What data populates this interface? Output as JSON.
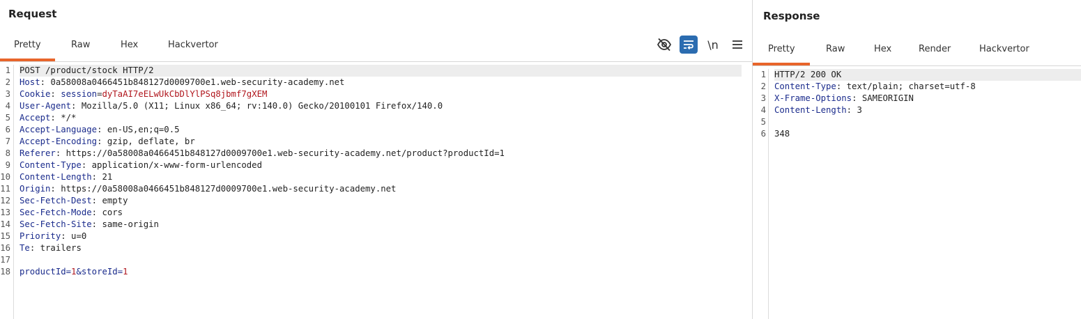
{
  "request": {
    "title": "Request",
    "tabs": [
      {
        "label": "Pretty",
        "active": true
      },
      {
        "label": "Raw",
        "active": false
      },
      {
        "label": "Hex",
        "active": false
      },
      {
        "label": "Hackvertor",
        "active": false
      }
    ],
    "toolbar": {
      "hide_icon": "eye-slash-icon",
      "wrap_icon": "word-wrap-icon",
      "newline_label": "\\n",
      "menu_icon": "hamburger-menu-icon"
    },
    "lines": [
      {
        "n": "1",
        "text": "POST /product/stock HTTP/2"
      },
      {
        "n": "2",
        "name": "Host",
        "sep": ": ",
        "value": "0a58008a0466451b848127d0009700e1.web-security-academy.net"
      },
      {
        "n": "3",
        "name": "Cookie",
        "sep": ": ",
        "cname": "session",
        "ceq": "=",
        "cvalue": "dyTaAI7eELwUkCbDlYlPSq8jbmf7gXEM"
      },
      {
        "n": "4",
        "name": "User-Agent",
        "sep": ": ",
        "value": "Mozilla/5.0 (X11; Linux x86_64; rv:140.0) Gecko/20100101 Firefox/140.0"
      },
      {
        "n": "5",
        "name": "Accept",
        "sep": ": ",
        "value": "*/*"
      },
      {
        "n": "6",
        "name": "Accept-Language",
        "sep": ": ",
        "value": "en-US,en;q=0.5"
      },
      {
        "n": "7",
        "name": "Accept-Encoding",
        "sep": ": ",
        "value": "gzip, deflate, br"
      },
      {
        "n": "8",
        "name": "Referer",
        "sep": ": ",
        "value": "https://0a58008a0466451b848127d0009700e1.web-security-academy.net/product?productId=1"
      },
      {
        "n": "9",
        "name": "Content-Type",
        "sep": ": ",
        "value": "application/x-www-form-urlencoded"
      },
      {
        "n": "10",
        "name": "Content-Length",
        "sep": ": ",
        "value": "21"
      },
      {
        "n": "11",
        "name": "Origin",
        "sep": ": ",
        "value": "https://0a58008a0466451b848127d0009700e1.web-security-academy.net"
      },
      {
        "n": "12",
        "name": "Sec-Fetch-Dest",
        "sep": ": ",
        "value": "empty"
      },
      {
        "n": "13",
        "name": "Sec-Fetch-Mode",
        "sep": ": ",
        "value": "cors"
      },
      {
        "n": "14",
        "name": "Sec-Fetch-Site",
        "sep": ": ",
        "value": "same-origin"
      },
      {
        "n": "15",
        "name": "Priority",
        "sep": ": ",
        "value": "u=0"
      },
      {
        "n": "16",
        "name": "Te",
        "sep": ": ",
        "value": "trailers"
      },
      {
        "n": "17",
        "text": ""
      },
      {
        "n": "18",
        "p1n": "productId",
        "p1e": "=",
        "p1v": "1",
        "amp": "&",
        "p2n": "storeId",
        "p2e": "=",
        "p2v": "1"
      }
    ]
  },
  "response": {
    "title": "Response",
    "tabs": [
      {
        "label": "Pretty",
        "active": true
      },
      {
        "label": "Raw",
        "active": false
      },
      {
        "label": "Hex",
        "active": false
      },
      {
        "label": "Render",
        "active": false
      },
      {
        "label": "Hackvertor",
        "active": false
      }
    ],
    "lines": [
      {
        "n": "1",
        "text": "HTTP/2 200 OK"
      },
      {
        "n": "2",
        "name": "Content-Type",
        "sep": ": ",
        "value": "text/plain; charset=utf-8"
      },
      {
        "n": "3",
        "name": "X-Frame-Options",
        "sep": ": ",
        "value": "SAMEORIGIN"
      },
      {
        "n": "4",
        "name": "Content-Length",
        "sep": ": ",
        "value": "3"
      },
      {
        "n": "5",
        "text": ""
      },
      {
        "n": "6",
        "text": "348"
      }
    ]
  },
  "colors": {
    "accent": "#e8652b",
    "header_name": "#1a2b8c",
    "cookie_value": "#b0161d",
    "toolbar_active": "#2b6cb0"
  }
}
